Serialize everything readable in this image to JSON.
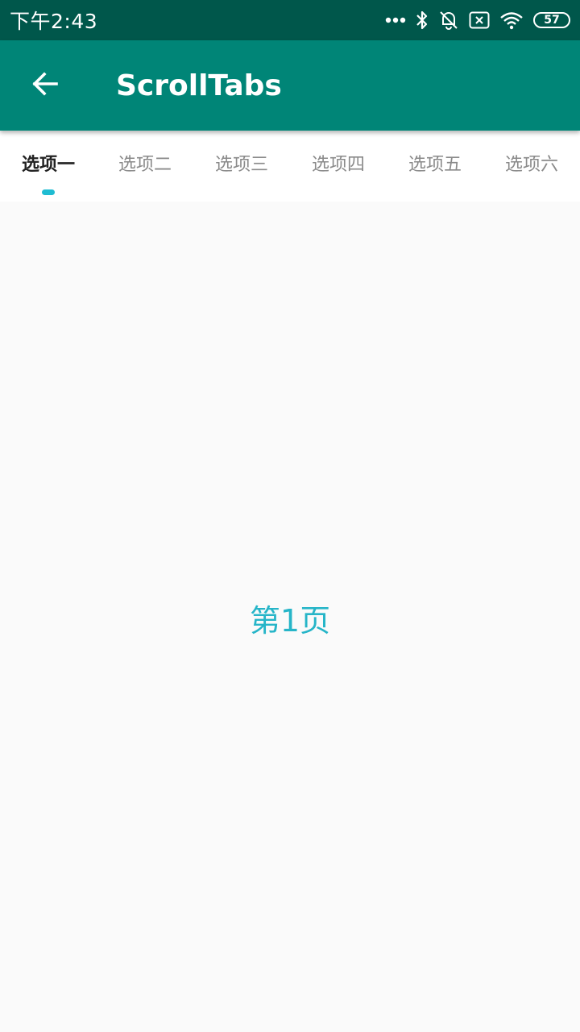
{
  "status_bar": {
    "time": "下午2:43",
    "battery_level": "57",
    "icons": [
      "more-dots-icon",
      "bluetooth-icon",
      "vibrate-off-icon",
      "sim-blocked-icon",
      "wifi-icon",
      "battery-icon"
    ]
  },
  "app_bar": {
    "back_icon": "arrow-back-icon",
    "title": "ScrollTabs",
    "color": "#008577",
    "status_color": "#00574b"
  },
  "tabs": [
    {
      "label": "选项一",
      "active": true
    },
    {
      "label": "选项二",
      "active": false
    },
    {
      "label": "选项三",
      "active": false
    },
    {
      "label": "选项四",
      "active": false
    },
    {
      "label": "选项五",
      "active": false
    },
    {
      "label": "选项六",
      "active": false
    }
  ],
  "indicator_color": "#1fbcd2",
  "content": {
    "page_label": "第1页",
    "label_color": "#26b5c8"
  }
}
